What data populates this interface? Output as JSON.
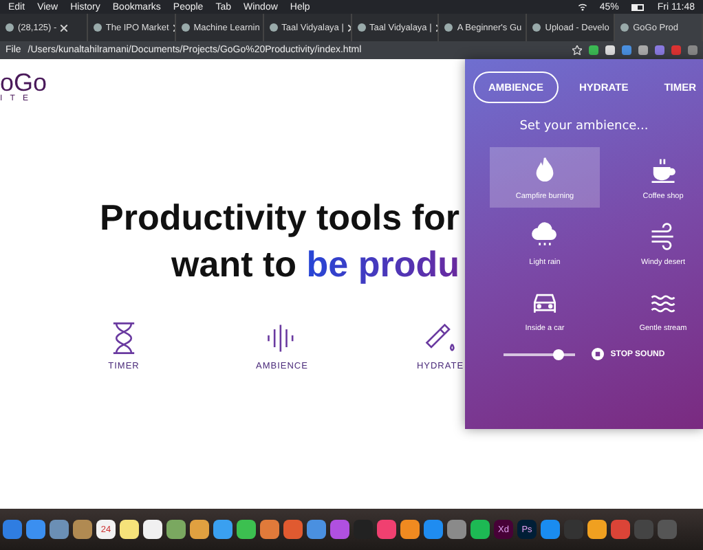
{
  "menubar": {
    "items": [
      "Edit",
      "View",
      "History",
      "Bookmarks",
      "People",
      "Tab",
      "Window",
      "Help"
    ],
    "battery": "45%",
    "clock": "Fri 11:48"
  },
  "tabs": [
    {
      "label": "(28,125) -",
      "selected": false
    },
    {
      "label": "The IPO Market",
      "selected": false
    },
    {
      "label": "Machine Learnin",
      "selected": false
    },
    {
      "label": "Taal Vidyalaya |",
      "selected": false
    },
    {
      "label": "Taal Vidyalaya |",
      "selected": false
    },
    {
      "label": "A Beginner's Gu",
      "selected": false
    },
    {
      "label": "Upload - Develo",
      "selected": false
    },
    {
      "label": "GoGo Prod",
      "selected": true
    }
  ],
  "address_bar": {
    "scheme": "File",
    "url": "/Users/kunaltahilramani/Documents/Projects/GoGo%20Productivity/index.html"
  },
  "page": {
    "logo": "oGo",
    "logo_sub": "I T E",
    "heading_line1": "Productivity tools for",
    "heading_line2": "want to",
    "heading_highlight": "be produ",
    "features": [
      {
        "kind": "hourglass",
        "label": "TIMER"
      },
      {
        "kind": "sound",
        "label": "AMBIENCE"
      },
      {
        "kind": "bottle",
        "label": "HYDRATE"
      }
    ]
  },
  "popup": {
    "tabs": [
      {
        "label": "AMBIENCE",
        "selected": true
      },
      {
        "label": "HYDRATE",
        "selected": false
      },
      {
        "label": "TIMER",
        "selected": false
      }
    ],
    "title": "Set your ambience...",
    "sounds": [
      {
        "kind": "fire",
        "label": "Campfire burning",
        "selected": true
      },
      {
        "kind": "coffee",
        "label": "Coffee shop",
        "selected": false
      },
      {
        "kind": "rain",
        "label": "Light rain",
        "selected": false
      },
      {
        "kind": "wind",
        "label": "Windy desert",
        "selected": false
      },
      {
        "kind": "car",
        "label": "Inside a car",
        "selected": false
      },
      {
        "kind": "water",
        "label": "Gentle stream",
        "selected": false
      }
    ],
    "volume": {
      "level": 0.78
    },
    "stop_button": "STOP SOUND"
  },
  "dock": [
    {
      "color": "#2f7de1"
    },
    {
      "color": "#3b8ff0"
    },
    {
      "color": "#6b8fb5"
    },
    {
      "color": "#b08a52"
    },
    {
      "color": "#f2f2f2",
      "label": "24"
    },
    {
      "color": "#f5e27a"
    },
    {
      "color": "#f0f0f0"
    },
    {
      "color": "#7aa860"
    },
    {
      "color": "#e0a040"
    },
    {
      "color": "#3aa0f0"
    },
    {
      "color": "#3cc050"
    },
    {
      "color": "#e07a3a"
    },
    {
      "color": "#e05a30"
    },
    {
      "color": "#4a90e0"
    },
    {
      "color": "#b050e0"
    },
    {
      "color": "#222222"
    },
    {
      "color": "#f04070"
    },
    {
      "color": "#f08a20"
    },
    {
      "color": "#1f8cf0"
    },
    {
      "color": "#8a8a8a"
    },
    {
      "color": "#1db954"
    },
    {
      "color": "#470137",
      "label": "Xd"
    },
    {
      "color": "#001e36",
      "label": "Ps"
    },
    {
      "color": "#1a8cf0"
    },
    {
      "color": "#333333"
    },
    {
      "color": "#f0a020"
    },
    {
      "color": "#db4437"
    },
    {
      "color": "#444444"
    },
    {
      "color": "#555555"
    }
  ]
}
